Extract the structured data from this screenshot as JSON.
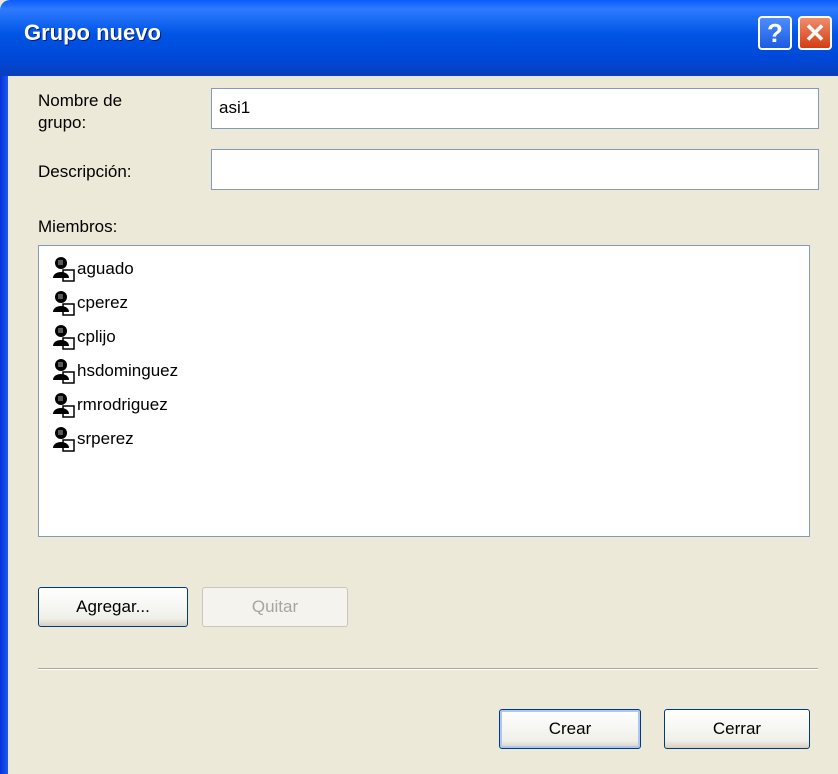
{
  "window": {
    "title": "Grupo nuevo",
    "help_glyph": "?",
    "close_glyph": "✕"
  },
  "form": {
    "group_name_label_line1": "Nombre de",
    "group_name_label_line2": "grupo:",
    "group_name_value": "asi1",
    "description_label": "Descripción:",
    "description_value": "",
    "members_label": "Miembros:"
  },
  "members": [
    "aguado",
    "cperez",
    "cplijo",
    "hsdominguez",
    "rmrodriguez",
    "srperez"
  ],
  "buttons": {
    "add": "Agregar...",
    "remove": "Quitar",
    "create": "Crear",
    "close": "Cerrar"
  },
  "icons": {
    "member": "user-icon"
  },
  "colors": {
    "title_bar": "#0055E5",
    "dialog_bg": "#ECE9D8",
    "field_border": "#7F9DB9"
  }
}
